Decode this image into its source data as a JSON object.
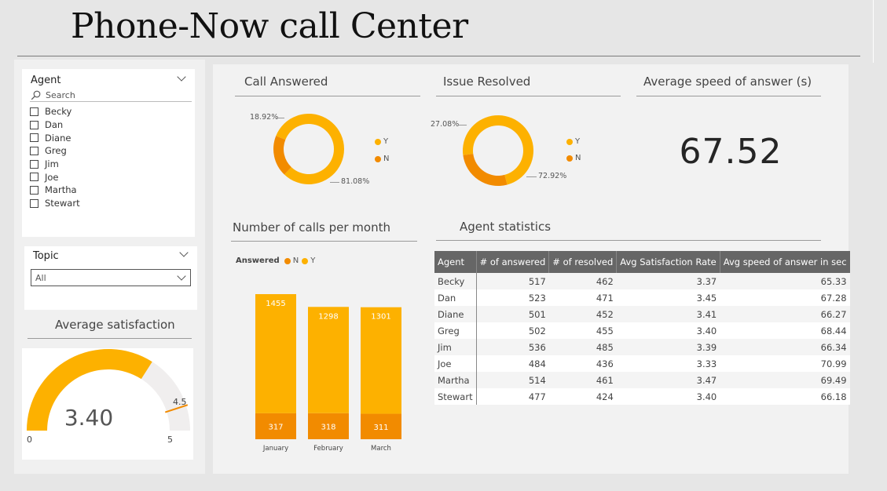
{
  "header": {
    "title": "Phone-Now call Center"
  },
  "agent_slicer": {
    "title": "Agent",
    "search_placeholder": "Search",
    "agents": [
      "Becky",
      "Dan",
      "Diane",
      "Greg",
      "Jim",
      "Joe",
      "Martha",
      "Stewart"
    ]
  },
  "topic_slicer": {
    "title": "Topic",
    "selected": "All"
  },
  "avg_satisfaction": {
    "title": "Average satisfaction",
    "value": "3.40",
    "value_num": 3.4,
    "min": "0",
    "max": "5",
    "target": "4.5",
    "target_num": 4.5,
    "fill_color": "#FDB100",
    "track_color": "#F0EEEE",
    "target_color": "#F28B00"
  },
  "call_answered": {
    "title": "Call Answered",
    "slices": [
      {
        "label": "Y",
        "value": 81.08,
        "pct_label": "81.08%",
        "color": "#FDB100"
      },
      {
        "label": "N",
        "value": 18.92,
        "pct_label": "18.92%",
        "color": "#F28B00"
      }
    ]
  },
  "issue_resolved": {
    "title": "Issue Resolved",
    "slices": [
      {
        "label": "Y",
        "value": 72.92,
        "pct_label": "72.92%",
        "color": "#FDB100"
      },
      {
        "label": "N",
        "value": 27.08,
        "pct_label": "27.08%",
        "color": "#F28B00"
      }
    ]
  },
  "speed_answer": {
    "title": "Average speed of answer (s)",
    "value": "67.52"
  },
  "chart_data": {
    "type": "bar",
    "title": "Number of calls per month",
    "legend_title": "Answered",
    "stacked": true,
    "categories": [
      "January",
      "February",
      "March"
    ],
    "series": [
      {
        "name": "N",
        "values": [
          317,
          318,
          311
        ],
        "color": "#F28B00"
      },
      {
        "name": "Y",
        "values": [
          1455,
          1298,
          1301
        ],
        "color": "#FDB100"
      }
    ],
    "legend_position": "top-left",
    "grid": false
  },
  "agent_stats": {
    "title": "Agent statistics",
    "columns": [
      "Agent",
      "# of answered",
      "# of resolved",
      "Avg Satisfaction Rate",
      "Avg speed of answer in sec"
    ],
    "rows": [
      [
        "Becky",
        "517",
        "462",
        "3.37",
        "65.33"
      ],
      [
        "Dan",
        "523",
        "471",
        "3.45",
        "67.28"
      ],
      [
        "Diane",
        "501",
        "452",
        "3.41",
        "66.27"
      ],
      [
        "Greg",
        "502",
        "455",
        "3.40",
        "68.44"
      ],
      [
        "Jim",
        "536",
        "485",
        "3.39",
        "66.34"
      ],
      [
        "Joe",
        "484",
        "436",
        "3.33",
        "70.99"
      ],
      [
        "Martha",
        "514",
        "461",
        "3.47",
        "69.49"
      ],
      [
        "Stewart",
        "477",
        "424",
        "3.40",
        "66.18"
      ]
    ]
  }
}
